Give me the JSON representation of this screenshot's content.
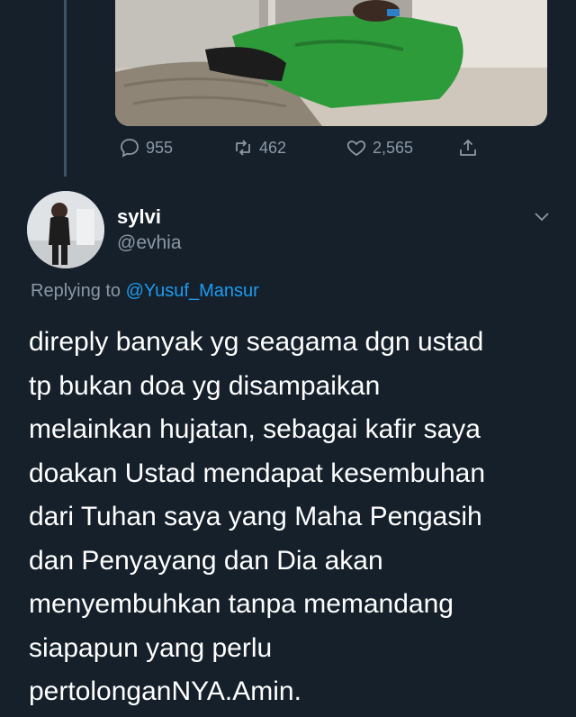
{
  "previous_tweet": {
    "media": {
      "description_icon": "hospital-photo"
    },
    "actions": {
      "reply_count": "955",
      "retweet_count": "462",
      "like_count": "2,565"
    }
  },
  "reply_tweet": {
    "author": {
      "name": "sylvi",
      "handle": "@evhia"
    },
    "replying_prefix": "Replying to",
    "replying_mention": "@Yusuf_Mansur",
    "text": "direply banyak yg seagama dgn ustad\ntp bukan doa yg disampaikan\nmelainkan hujatan, sebagai kafir saya\ndoakan Ustad mendapat kesembuhan\ndari Tuhan saya yang Maha Pengasih\ndan Penyayang dan Dia akan\nmenyembuhkan tanpa memandang\nsiapapun yang perlu\npertolonganNYA.Amin."
  },
  "colors": {
    "background": "#15202b",
    "secondary_text": "#8b98a5",
    "link": "#1d9bf0"
  }
}
